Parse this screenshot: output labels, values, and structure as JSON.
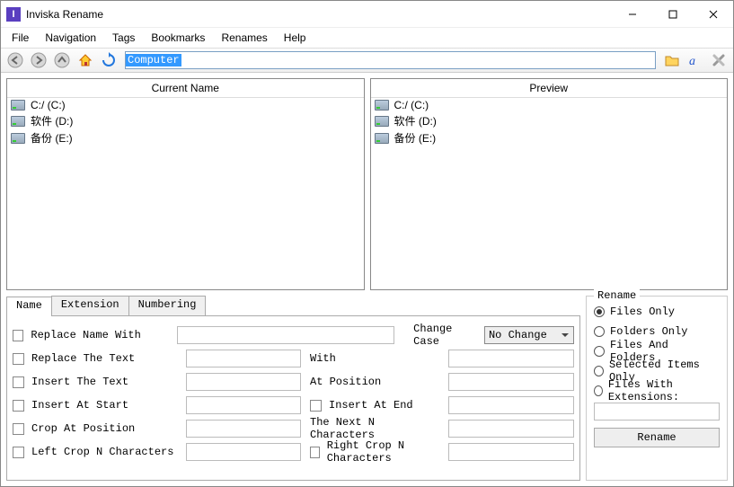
{
  "window": {
    "title": "Inviska Rename",
    "icon_letter": "I"
  },
  "menu": {
    "file": "File",
    "navigation": "Navigation",
    "tags": "Tags",
    "bookmarks": "Bookmarks",
    "renames": "Renames",
    "help": "Help"
  },
  "address": {
    "value": "Computer"
  },
  "panels": {
    "current_header": "Current Name",
    "preview_header": "Preview",
    "items": [
      {
        "label": "C:/ (C:)"
      },
      {
        "label": "软件 (D:)"
      },
      {
        "label": "备份 (E:)"
      }
    ]
  },
  "tabs": {
    "name": "Name",
    "extension": "Extension",
    "numbering": "Numbering"
  },
  "form": {
    "replace_name_with": "Replace Name With",
    "replace_the_text": "Replace The Text",
    "with_lbl": "With",
    "insert_the_text": "Insert The Text",
    "at_position": "At Position",
    "insert_at_start": "Insert At Start",
    "insert_at_end": "Insert At End",
    "crop_at_position": "Crop At Position",
    "next_n_chars": "The Next N Characters",
    "left_crop": "Left Crop N Characters",
    "right_crop": "Right Crop N Characters",
    "change_case": "Change Case",
    "change_case_value": "No Change"
  },
  "rename": {
    "group_title": "Rename",
    "files_only": "Files Only",
    "folders_only": "Folders Only",
    "files_and_folders": "Files And Folders",
    "selected_only": "Selected Items Only",
    "files_with_ext": "Files With Extensions:",
    "button": "Rename"
  }
}
